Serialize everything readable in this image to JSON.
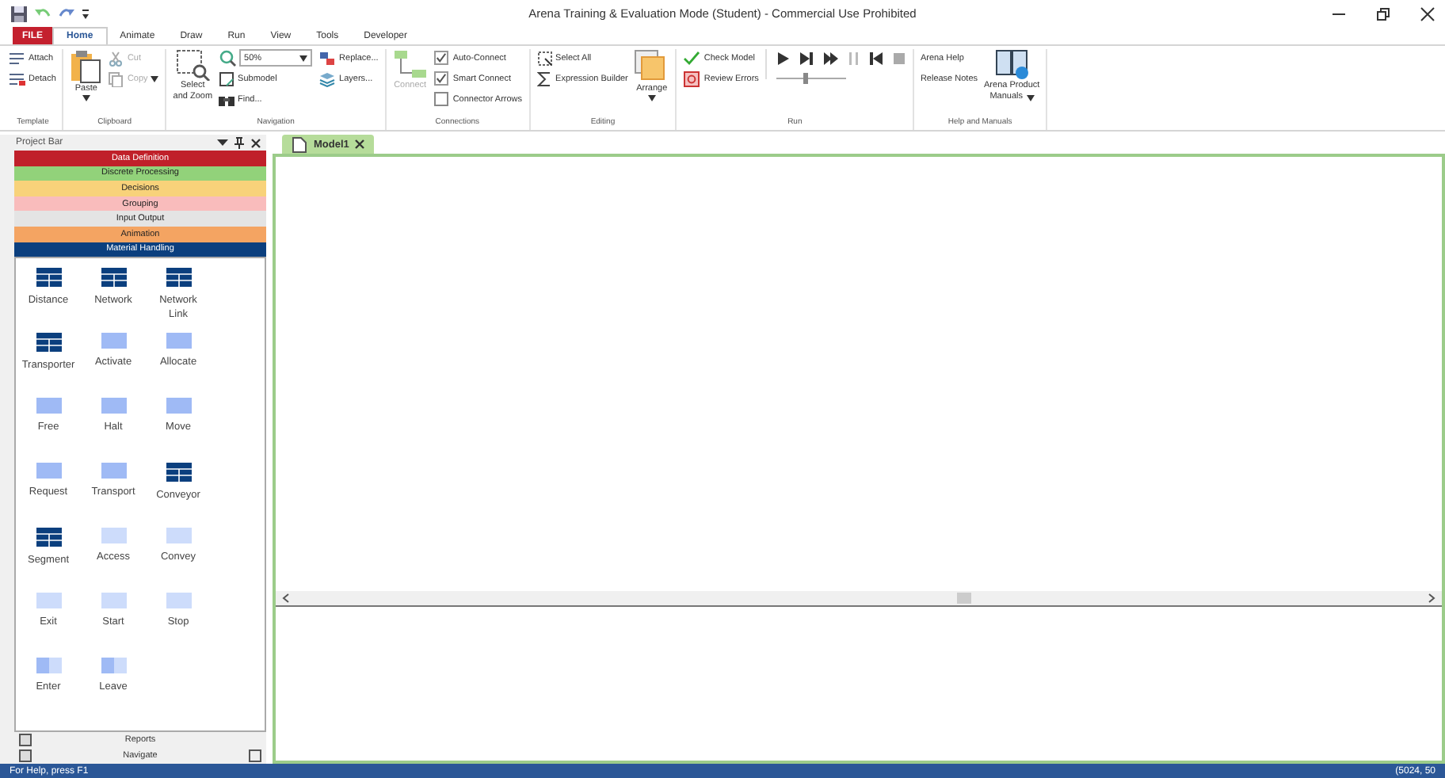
{
  "window": {
    "title": "Arena Training & Evaluation Mode (Student) - Commercial Use Prohibited"
  },
  "ribbon_tabs": [
    {
      "label": "FILE",
      "kind": "file",
      "selected": false
    },
    {
      "label": "Home",
      "kind": "tab",
      "selected": true
    },
    {
      "label": "Animate",
      "kind": "tab",
      "selected": false
    },
    {
      "label": "Draw",
      "kind": "tab",
      "selected": false
    },
    {
      "label": "Run",
      "kind": "tab",
      "selected": false
    },
    {
      "label": "View",
      "kind": "tab",
      "selected": false
    },
    {
      "label": "Tools",
      "kind": "tab",
      "selected": false
    },
    {
      "label": "Developer",
      "kind": "tab",
      "selected": false
    }
  ],
  "ribbon": {
    "template": {
      "label": "Template",
      "attach": "Attach",
      "detach": "Detach"
    },
    "clipboard": {
      "label": "Clipboard",
      "paste": "Paste",
      "cut": {
        "label": "Cut",
        "disabled": true
      },
      "copy": {
        "label": "Copy",
        "disabled": true
      }
    },
    "navigation": {
      "label": "Navigation",
      "select_zoom": "Select\nand Zoom",
      "zoom_value": "50%",
      "submodel": "Submodel",
      "find": "Find...",
      "replace": "Replace...",
      "layers": "Layers..."
    },
    "connections": {
      "label": "Connections",
      "connect": {
        "label": "Connect",
        "disabled": true
      },
      "options": [
        {
          "label": "Auto-Connect",
          "checked": true
        },
        {
          "label": "Smart Connect",
          "checked": true
        },
        {
          "label": "Connector Arrows",
          "checked": false
        }
      ]
    },
    "editing": {
      "label": "Editing",
      "select_all": "Select All",
      "expression_builder": "Expression Builder",
      "arrange": "Arrange"
    },
    "run": {
      "label": "Run",
      "check_model": "Check Model",
      "review_errors": "Review Errors",
      "speed": {
        "level": 0.4
      }
    },
    "help": {
      "label": "Help and Manuals",
      "arena_help": "Arena Help",
      "release_notes": "Release Notes",
      "manuals": "Arena Product\nManuals"
    }
  },
  "project_bar": {
    "title": "Project Bar",
    "panels": [
      {
        "label": "Data Definition",
        "color": "#c0202a"
      },
      {
        "label": "Discrete Processing",
        "color": "#92d27a"
      },
      {
        "label": "Decisions",
        "color": "#f8d27a"
      },
      {
        "label": "Grouping",
        "color": "#f9bcbc"
      },
      {
        "label": "Input Output",
        "color": "#e4e4e4"
      },
      {
        "label": "Animation",
        "color": "#f4a462"
      },
      {
        "label": "Material Handling",
        "color": "#0b3f7e"
      }
    ],
    "modules": [
      {
        "label": "Distance",
        "kind": "table"
      },
      {
        "label": "Network",
        "kind": "table"
      },
      {
        "label": "Network\nLink",
        "kind": "table"
      },
      {
        "label": "Transporter",
        "kind": "table"
      },
      {
        "label": "Activate",
        "kind": "block"
      },
      {
        "label": "Allocate",
        "kind": "block"
      },
      {
        "label": "Free",
        "kind": "block"
      },
      {
        "label": "Halt",
        "kind": "block"
      },
      {
        "label": "Move",
        "kind": "block"
      },
      {
        "label": "Request",
        "kind": "block"
      },
      {
        "label": "Transport",
        "kind": "block"
      },
      {
        "label": "Conveyor",
        "kind": "table"
      },
      {
        "label": "Segment",
        "kind": "table"
      },
      {
        "label": "Access",
        "kind": "pale"
      },
      {
        "label": "Convey",
        "kind": "pale"
      },
      {
        "label": "Exit",
        "kind": "pale"
      },
      {
        "label": "Start",
        "kind": "pale"
      },
      {
        "label": "Stop",
        "kind": "pale"
      },
      {
        "label": "Enter",
        "kind": "split"
      },
      {
        "label": "Leave",
        "kind": "split"
      }
    ],
    "footer": [
      {
        "label": "Reports"
      },
      {
        "label": "Navigate"
      }
    ]
  },
  "document_tabs": [
    {
      "label": "Model1",
      "selected": true
    }
  ],
  "status_bar": {
    "left": "For Help, press F1",
    "right": "(5024, 50"
  }
}
